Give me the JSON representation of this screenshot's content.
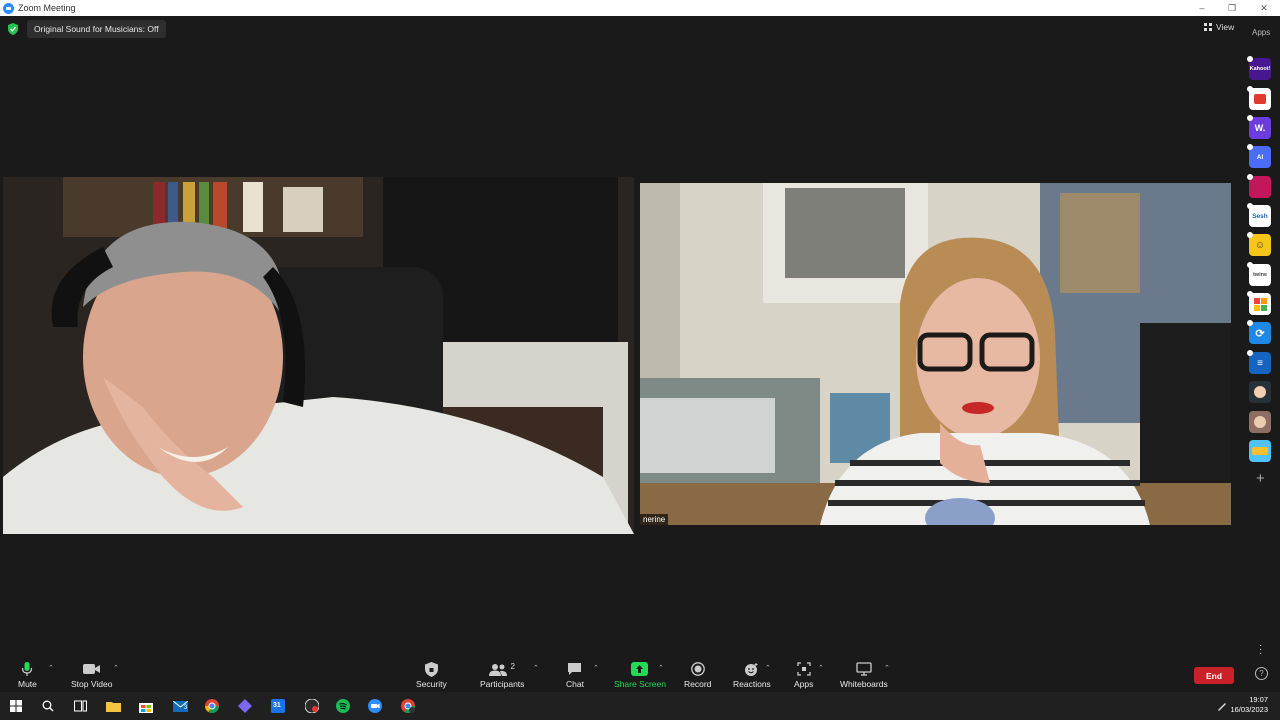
{
  "window": {
    "title": "Zoom Meeting"
  },
  "banner": {
    "original_sound": "Original Sound for Musicians: Off"
  },
  "top_right": {
    "view_label": "View",
    "apps_label": "Apps"
  },
  "participants": {
    "right_name": "nerine"
  },
  "side_apps": [
    {
      "name": "Kahoot!",
      "label": "Kahoot!",
      "color": "#46178f"
    },
    {
      "name": "app-red",
      "label": "",
      "color": "#e03a2f"
    },
    {
      "name": "Wooclap",
      "label": "W.",
      "color": "#6b3dde"
    },
    {
      "name": "app-ai",
      "label": "AI",
      "color": "#4a6cf7"
    },
    {
      "name": "app-stripes",
      "label": "",
      "color": "#c2185b"
    },
    {
      "name": "Sesh",
      "label": "Sesh",
      "color": "#ffffff"
    },
    {
      "name": "app-smile",
      "label": "",
      "color": "#f5c518"
    },
    {
      "name": "Twine",
      "label": "twine",
      "color": "#ffffff"
    },
    {
      "name": "app-grid",
      "label": "",
      "color": "#ffffff"
    },
    {
      "name": "app-sync",
      "label": "",
      "color": "#1e88e5"
    },
    {
      "name": "app-e",
      "label": "",
      "color": "#1565c0"
    },
    {
      "name": "app-avatar1",
      "label": "",
      "color": "#263238"
    },
    {
      "name": "app-avatar2",
      "label": "",
      "color": "#8d6e63"
    },
    {
      "name": "app-scene",
      "label": "",
      "color": "#4fc3f7"
    }
  ],
  "toolbar": {
    "mute": "Mute",
    "stop_video": "Stop Video",
    "security": "Security",
    "participants": "Participants",
    "participants_count": "2",
    "chat": "Chat",
    "share_screen": "Share Screen",
    "record": "Record",
    "reactions": "Reactions",
    "apps": "Apps",
    "whiteboards": "Whiteboards",
    "end": "End"
  },
  "colors": {
    "share_green": "#23d959",
    "end_red": "#c9202a",
    "zoom_blue": "#2d8cff"
  },
  "taskbar": {
    "time": "19:07",
    "date": "16/03/2023",
    "badge_count": "3",
    "calendar_day": "31"
  }
}
